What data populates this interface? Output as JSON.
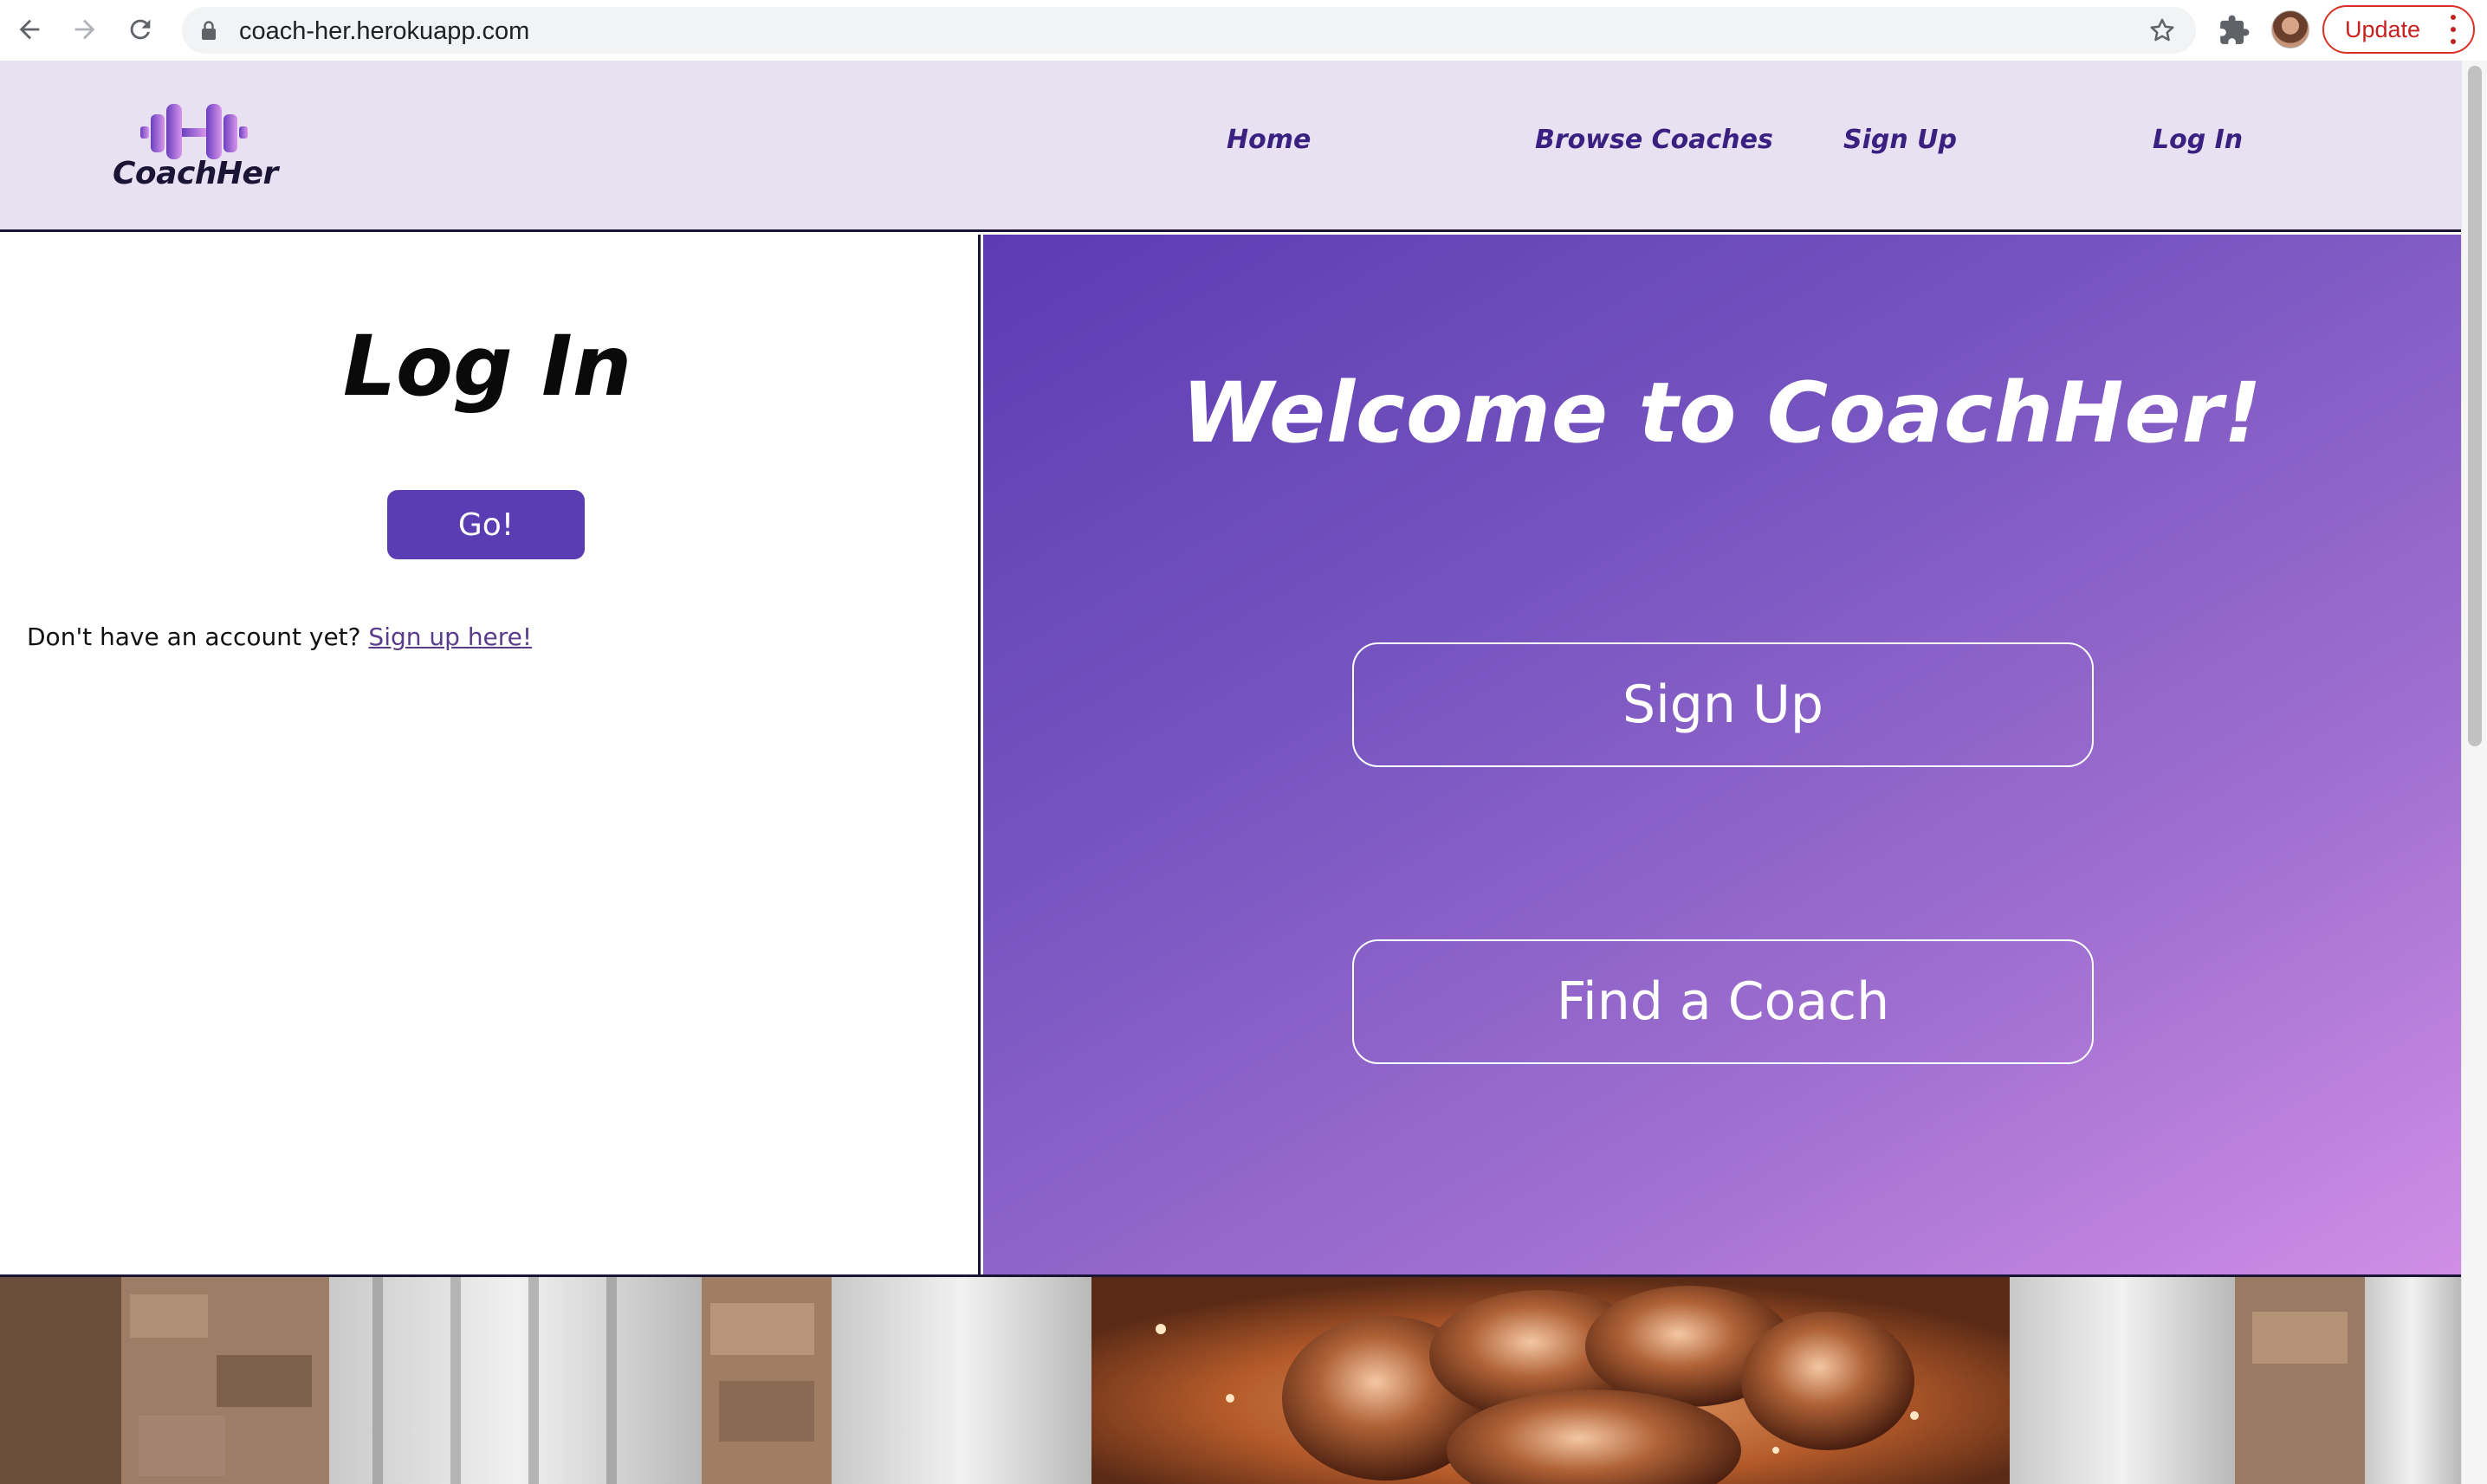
{
  "browser": {
    "url": "coach-her.herokuapp.com",
    "update_label": "Update"
  },
  "site": {
    "logo_text": "CoachHer",
    "nav": [
      {
        "label": "Home"
      },
      {
        "label": "Browse Coaches"
      },
      {
        "label": "Sign Up"
      },
      {
        "label": "Log In"
      }
    ]
  },
  "login": {
    "title": "Log In",
    "go_label": "Go!",
    "no_account_text": "Don't have an account yet?",
    "signup_link": "Sign up here!"
  },
  "hero": {
    "welcome": "Welcome to CoachHer!",
    "signup_button": "Sign Up",
    "find_coach_button": "Find a Coach"
  },
  "colors": {
    "header_bg": "#e8e1f2",
    "nav_text": "#3a2080",
    "go_button": "#5a3db3",
    "hero_gradient_start": "#5b3cb2",
    "hero_gradient_end": "#d08ee6",
    "update_red": "#d93025"
  },
  "icons": [
    "back-arrow-icon",
    "forward-arrow-icon",
    "reload-icon",
    "lock-icon",
    "star-icon",
    "extensions-puzzle-icon",
    "profile-avatar",
    "kebab-menu-icon",
    "dumbbell-logo-icon"
  ]
}
